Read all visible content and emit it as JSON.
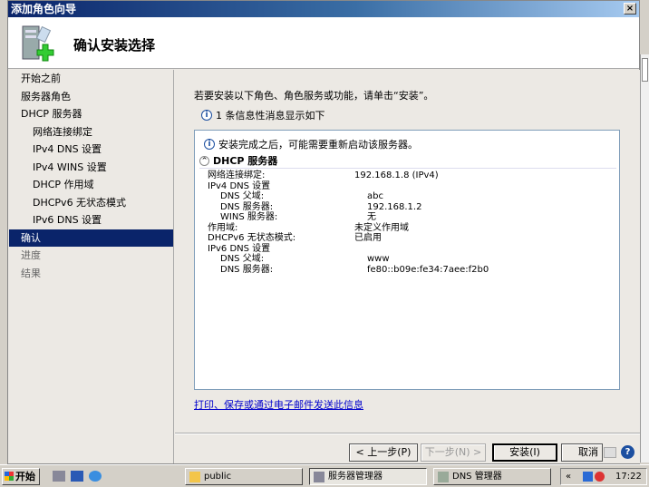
{
  "window": {
    "title": "添加角色向导",
    "page_title": "确认安装选择"
  },
  "nav": [
    {
      "label": "开始之前",
      "level": 0,
      "state": "normal"
    },
    {
      "label": "服务器角色",
      "level": 0,
      "state": "normal"
    },
    {
      "label": "DHCP 服务器",
      "level": 0,
      "state": "normal"
    },
    {
      "label": "网络连接绑定",
      "level": 1,
      "state": "normal"
    },
    {
      "label": "IPv4 DNS 设置",
      "level": 1,
      "state": "normal"
    },
    {
      "label": "IPv4 WINS 设置",
      "level": 1,
      "state": "normal"
    },
    {
      "label": "DHCP 作用域",
      "level": 1,
      "state": "normal"
    },
    {
      "label": "DHCPv6 无状态模式",
      "level": 1,
      "state": "normal"
    },
    {
      "label": "IPv6 DNS 设置",
      "level": 1,
      "state": "normal"
    },
    {
      "label": "确认",
      "level": 0,
      "state": "selected"
    },
    {
      "label": "进度",
      "level": 0,
      "state": "dim"
    },
    {
      "label": "结果",
      "level": 0,
      "state": "dim"
    }
  ],
  "main": {
    "intro": "若要安装以下角色、角色服务或功能，请单击“安装”。",
    "message_count": "1 条信息性消息显示如下",
    "restart_note": "安装完成之后，可能需要重新启动该服务器。",
    "section_title": "DHCP 服务器",
    "rows": [
      {
        "k": "网络连接绑定:",
        "v": "192.168.1.8 (IPv4)",
        "indent": false
      },
      {
        "k": "IPv4 DNS 设置",
        "v": "",
        "indent": false
      },
      {
        "k": "DNS 父域:",
        "v": "abc",
        "indent": true
      },
      {
        "k": "DNS 服务器:",
        "v": "192.168.1.2",
        "indent": true
      },
      {
        "k": "WINS 服务器:",
        "v": "无",
        "indent": true
      },
      {
        "k": "作用域:",
        "v": "未定义作用域",
        "indent": false
      },
      {
        "k": "DHCPv6 无状态模式:",
        "v": "已启用",
        "indent": false
      },
      {
        "k": "IPv6 DNS 设置",
        "v": "",
        "indent": false
      },
      {
        "k": "DNS 父域:",
        "v": "www",
        "indent": true
      },
      {
        "k": "DNS 服务器:",
        "v": "fe80::b09e:fe34:7aee:f2b0",
        "indent": true
      }
    ],
    "link": "打印、保存或通过电子邮件发送此信息"
  },
  "buttons": {
    "prev": "< 上一步(P)",
    "next": "下一步(N) >",
    "install": "安装(I)",
    "cancel": "取消"
  },
  "taskbar": {
    "start": "开始",
    "tasks": [
      "public",
      "服务器管理器",
      "DNS 管理器"
    ],
    "tray_expand": "«",
    "clock": "17:22"
  }
}
